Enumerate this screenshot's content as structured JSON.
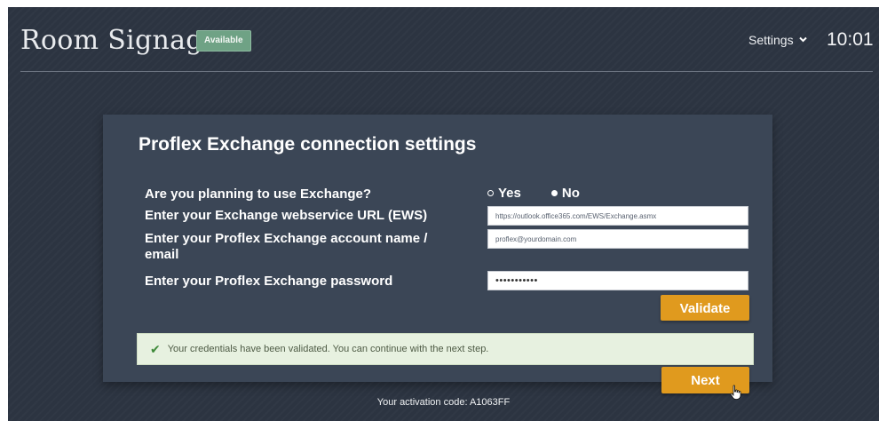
{
  "header": {
    "title": "Room Signage",
    "status_badge": "Available",
    "settings_label": "Settings",
    "time": "10:01"
  },
  "form": {
    "title": "Proflex Exchange connection settings",
    "use_exchange_label": "Are you planning to use Exchange?",
    "options": {
      "yes": "Yes",
      "no": "No"
    },
    "selected_option": "No",
    "ews_label": "Enter your Exchange webservice URL (EWS)",
    "ews_value": "https://outlook.office365.com/EWS/Exchange.asmx",
    "account_label": "Enter your Proflex Exchange account name / email",
    "account_value": "proflex@yourdomain.com",
    "password_label": "Enter your Proflex Exchange password",
    "password_value": "•••••••••••",
    "validate_label": "Validate",
    "success_message": "Your credentials have been validated. You can continue with the next step.",
    "next_label": "Next"
  },
  "footer": {
    "activation_text": "Your activation code: A1063FF"
  },
  "icons": {
    "settings_chevron": "chevron-down-icon",
    "success": "check-icon",
    "pointer": "hand-pointer-icon"
  },
  "colors": {
    "background": "#2c3441",
    "card": "#3b4656",
    "accent": "#e09a1e",
    "badge": "#6fa285",
    "success_bg": "#e7f1e0"
  }
}
